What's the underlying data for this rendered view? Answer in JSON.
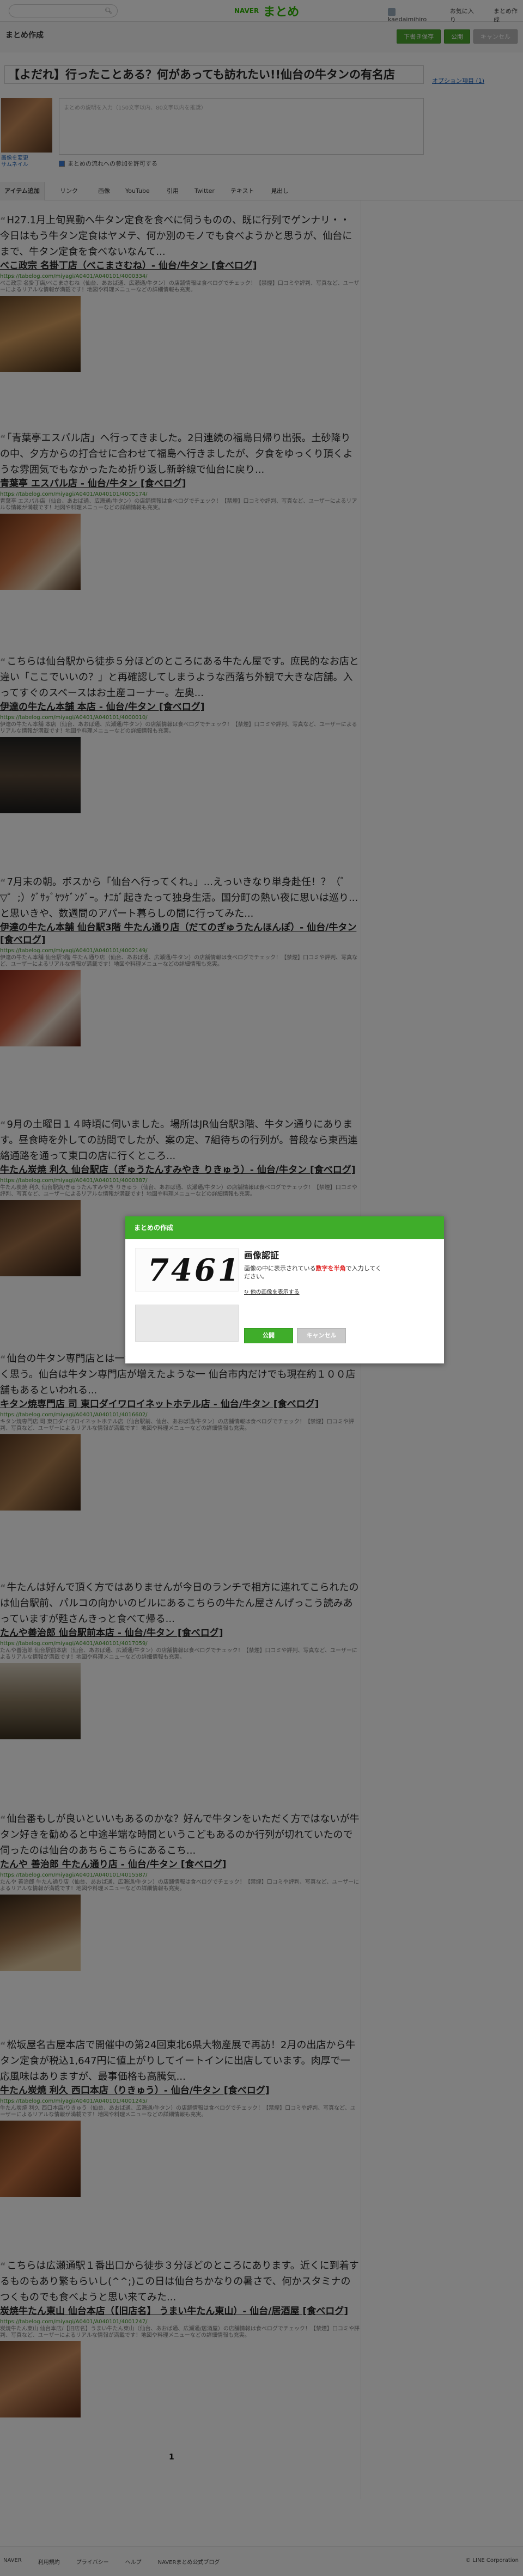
{
  "topbar": {
    "search_icon": "search-icon",
    "logo_naver": "NAVER",
    "logo_matome": "まとめ",
    "user_name": "kaedaimihiro",
    "favorites": "お気に入り",
    "my_matome": "まとめ作成"
  },
  "create": {
    "label": "まとめ作成",
    "btn_save_draft": "下書き保存",
    "btn_publish": "公開",
    "btn_other": "キャンセル"
  },
  "title": {
    "value": "【よだれ】行ったことある？何があっても訪れたい!!仙台の牛タンの有名店",
    "option_link": "オプション項目 (1)",
    "thumb_labels": [
      "画像を変更",
      "サムネイル"
    ],
    "desc_placeholder": "まとめの説明を入力（150文字以内、80文字以内を推奨）",
    "check_label": "まとめの流れへの参加を許可する"
  },
  "toolbar": {
    "tabs": [
      "アイテム追加",
      "リンク",
      "画像",
      "YouTube",
      "引用",
      "Twitter",
      "テキスト",
      "見出し"
    ]
  },
  "items": [
    {
      "quote": "H27.1月上旬異動へ牛タン定食を食べに伺うものの、既に行列でゲンナリ・・今日はもう牛タン定食はヤメテ、何か別のモノでも食べようかと思うが、仙台にまで、牛タン定食を食べないなんて...",
      "title": "べこ政宗 名掛丁店（べこまさむね）- 仙台/牛タン [食べログ]",
      "url": "https://tabelog.com/miyagi/A0401/A040101/4000334/",
      "desc": "べこ政宗 名掛丁店/べこまさむね（仙台、あおば通、広瀬通/牛タン）の店舗情報は食べログでチェック！【禁煙】口コミや評判、写真など、ユーザーによるリアルな情報が満載です！地図や料理メニューなどの詳細情報も充実。"
    },
    {
      "quote": "「青葉亭エスパル店」へ行ってきました。2日連続の福島日帰り出張。土砂降りの中、夕方からの打合せに合わせて福島へ行きましたが、夕食をゆっくり頂くような雰囲気でもなかったため折り返し新幹線で仙台に戻り...",
      "title": "青葉亭 エスパル店 - 仙台/牛タン [食べログ]",
      "url": "https://tabelog.com/miyagi/A0401/A040101/4005174/",
      "desc": "青葉亭 エスパル店（仙台、あおば通、広瀬通/牛タン）の店舗情報は食べログでチェック！【禁煙】口コミや評判、写真など、ユーザーによるリアルな情報が満載です！地図や料理メニューなどの詳細情報も充実。"
    },
    {
      "quote": "こちらは仙台駅から徒歩５分ほどのところにある牛たん屋です。庶民的なお店と違い「ここでいいの？」と再確認してしまうような西落ち外観で大きな店舗。入ってすぐのスペースはお土産コーナー。左奥...",
      "title": "伊達の牛たん本舗 本店 - 仙台/牛タン [食べログ]",
      "url": "https://tabelog.com/miyagi/A0401/A040101/4000010/",
      "desc": "伊達の牛たん本舗 本店（仙台、あおば通、広瀬通/牛タン）の店舗情報は食べログでチェック！【禁煙】口コミや評判、写真など、ユーザーによるリアルな情報が満載です！地図や料理メニューなどの詳細情報も充実。"
    },
    {
      "quote": "7月末の朝。ボスから「仙台へ行ってくれ。」...えっいきなり単身赴任！？（゜▽゜;）ｸﾞｻｯﾞﾔﾂｹﾞﾝｸﾞｰ。ﾅﾆｶﾞ起きたって独身生活。国分町の熱い夜に思いは巡り...と思いきや、数週間のアパート暮らしの間に行ってみた...",
      "title": "伊達の牛たん本舗 仙台駅3階 牛たん通り店（だてのぎゅうたんほんぽ）- 仙台/牛タン [食べログ]",
      "url": "https://tabelog.com/miyagi/A0401/A040101/4002149/",
      "desc": "伊達の牛たん本舗 仙台駅3階 牛たん通り店（仙台、あおば通、広瀬通/牛タン）の店舗情報は食べログでチェック！【禁煙】口コミや評判、写真など、ユーザーによるリアルな情報が満載です！地図や料理メニューなどの詳細情報も充実。"
    },
    {
      "quote": "9月の土曜日１４時頃に伺いました。場所はJR仙台駅3階、牛タン通りにあります。昼食時を外しての訪問でしたが、案の定、7組待ちの行列が。普段なら東西連絡通路を通って東口の店に行くところ...",
      "title": "牛たん炭焼 利久 仙台駅店（ぎゅうたんすみやき りきゅう）- 仙台/牛タン [食べログ]",
      "url": "https://tabelog.com/miyagi/A0401/A040101/4000387/",
      "desc": "牛たん炭焼 利久 仙台駅店/ぎゅうたんすみやき りきゅう（仙台、あおば通、広瀬通/牛タン）の店舗情報は食べログでチェック！【禁煙】口コミや評判、写真など、ユーザーによるリアルな情報が満載です！地図や料理メニューなどの詳細情報も充実。"
    },
    {
      "quote": "仙台の牛タン専門店とは一線を画した牛タンの塩焼定食ではなく、まあつくづく思う。仙台は牛タン専門店が増えたような一 仙台市内だけでも現在約１００店舗もあるといわれる...",
      "title": "キタン焼専門店 司 東口ダイワロイネットホテル店 - 仙台/牛タン [食べログ]",
      "url": "https://tabelog.com/miyagi/A0401/A040101/4016602/",
      "desc": "キタン焼専門店 司 東口ダイワロイネットホテル店（仙台駅前、仙台、あおば通/牛タン）の店舗情報は食べログでチェック！【禁煙】口コミや評判、写真など、ユーザーによるリアルな情報が満載です！地図や料理メニューなどの詳細情報も充実。"
    },
    {
      "quote": "牛たんは好んで頂く方ではありませんが今日のランチで相方に連れてこられたのは仙台駅前、パルコの向かいのビルにあるこちらの牛たん屋さんげっこう読みあっていますが甦さんきっと食べて帰る...",
      "title": "たんや善治郎 仙台駅前本店 - 仙台/牛タン [食べログ]",
      "url": "https://tabelog.com/miyagi/A0401/A040101/4017059/",
      "desc": "たんや善治郎 仙台駅前本店（仙台、あおば通、広瀬通/牛タン）の店舗情報は食べログでチェック！【禁煙】口コミや評判、写真など、ユーザーによるリアルな情報が満載です！地図や料理メニューなどの詳細情報も充実。"
    },
    {
      "quote": "仙台番もしが良いといいもあるのかな？好んで牛タンをいただく方ではないが牛タン好きを勧めると中途半端な時間というこどもあるのか行列が切れていたので伺ったのは仙台のあちらこちらにあるこち...",
      "title": "たんや 善治郎 牛たん通り店 - 仙台/牛タン [食べログ]",
      "url": "https://tabelog.com/miyagi/A0401/A040101/4015587/",
      "desc": "たんや 善治郎 牛たん通り店（仙台、あおば通、広瀬通/牛タン）の店舗情報は食べログでチェック！【禁煙】口コミや評判、写真など、ユーザーによるリアルな情報が満載です！地図や料理メニューなどの詳細情報も充実。"
    },
    {
      "quote": "松坂屋名古屋本店で開催中の第24回東北6県大物産展で再訪！2月の出店から牛タン定食が税込1,647円に値上がりしてイートインに出店しています。肉厚で一応風味はありますが、最事価格も高騰気...",
      "title": "牛たん炭焼 利久 西口本店（りきゅう）- 仙台/牛タン [食べログ]",
      "url": "https://tabelog.com/miyagi/A0401/A040101/4001245/",
      "desc": "牛たん炭焼 利久 西口本店/りきゅう（仙台、あおば通、広瀬通/牛タン）の店舗情報は食べログでチェック！【禁煙】口コミや評判、写真など、ユーザーによるリアルな情報が満載です！地図や料理メニューなどの詳細情報も充実。"
    },
    {
      "quote": "こちらは広瀬通駅１番出口から徒歩３分ほどのところにあります。近くに到着するものもあり繁もらいし(^^;)この日は仙台ちかなりの暑さで、何かスタミナのつくものでも食べようと思い来てみた...",
      "title": "炭焼牛たん東山 仙台本店（【旧店名】 うまい牛たん東山）- 仙台/居酒屋 [食べログ]",
      "url": "https://tabelog.com/miyagi/A0401/A040101/4001247/",
      "desc": "炭焼牛たん東山 仙台本店/【旧店名】うまい牛たん東山（仙台、あおば通、広瀬通/居酒屋）の店舗情報は食べログでチェック！【禁煙】口コミや評判、写真など、ユーザーによるリアルな情報が満載です！地図や料理メニューなどの詳細情報も充実。"
    }
  ],
  "pager": {
    "current": "1"
  },
  "footer": {
    "links": [
      "NAVER",
      "利用規約",
      "プライバシー",
      "ヘルプ",
      "NAVERまとめ公式ブログ"
    ],
    "corp": "© LINE Corporation"
  },
  "modal": {
    "header": "まとめの作成",
    "captcha_value": "7461",
    "title": "画像認証",
    "text_before": "画像の中に表示されている",
    "text_red": "数字を半角",
    "text_after": "で入力してください。",
    "reload": "他の画像を表示する",
    "submit": "公開",
    "cancel": "キャンセル"
  },
  "colors": {
    "accent_green": "#3fad2a",
    "overlay": "rgba(0,0,0,0.5)",
    "warning_red": "#e02020"
  }
}
